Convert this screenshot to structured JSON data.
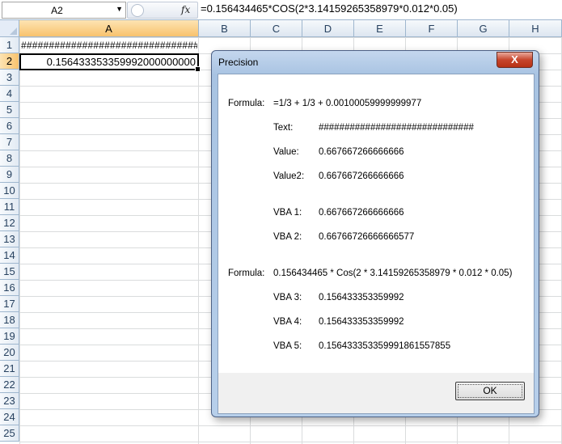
{
  "formula_bar": {
    "name_box": "A2",
    "fx": "fx",
    "formula": "=0.156434465*COS(2*3.14159265358979*0.012*0.05)"
  },
  "columns": [
    "A",
    "B",
    "C",
    "D",
    "E",
    "F",
    "G",
    "H"
  ],
  "rows": [
    "1",
    "2",
    "3",
    "4",
    "5",
    "6",
    "7",
    "8",
    "9",
    "10",
    "11",
    "12",
    "13",
    "14",
    "15",
    "16",
    "17",
    "18",
    "19",
    "20",
    "21",
    "22",
    "23",
    "24",
    "25"
  ],
  "cells": {
    "A1": "################################",
    "A2": "0.156433353359992000000000"
  },
  "dialog": {
    "title": "Precision",
    "close": "X",
    "formula1_label": "Formula:",
    "formula1": "=1/3 + 1/3 + 0.00100059999999977",
    "text_label": "Text:",
    "text_value": "##############################",
    "value_label": "Value:",
    "value_value": "0.667667266666666",
    "value2_label": "Value2:",
    "value2_value": "0.667667266666666",
    "vba1_label": "VBA 1:",
    "vba1_value": "0.667667266666666",
    "vba2_label": "VBA 2:",
    "vba2_value": "0.66766726666666577",
    "formula2_label": "Formula:",
    "formula2": "0.156434465 * Cos(2 * 3.14159265358979 * 0.012 * 0.05)",
    "vba3_label": "VBA 3:",
    "vba3_value": "0.156433353359992",
    "vba4_label": "VBA 4:",
    "vba4_value": "0.156433353359992",
    "vba5_label": "VBA 5:",
    "vba5_value": "0.156433353359991861557855",
    "ok_label": "OK"
  }
}
